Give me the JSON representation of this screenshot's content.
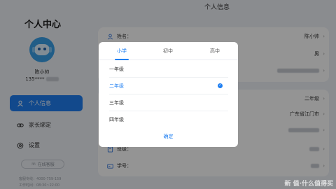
{
  "sidebar": {
    "title": "个人中心",
    "user_name": "陈小帅",
    "phone_prefix": "135****",
    "nav": [
      {
        "label": "个人信息",
        "icon": "user-icon",
        "active": true
      },
      {
        "label": "家长绑定",
        "icon": "link-icon",
        "active": false
      },
      {
        "label": "设置",
        "icon": "gear-icon",
        "active": false
      }
    ],
    "online_service": "在线客服",
    "service_phone": "客服专线：4000-759-159",
    "service_hours": "工作时间：08:30~22:00"
  },
  "main": {
    "title": "个人信息",
    "card1": [
      {
        "label": "姓名：",
        "value": "陈小帅",
        "icon": "user-icon"
      },
      {
        "label": "",
        "value": "男",
        "icon": ""
      },
      {
        "label": "",
        "value": "",
        "icon": ""
      }
    ],
    "card2": [
      {
        "label": "",
        "value": "二年级",
        "icon": ""
      },
      {
        "label": "",
        "value": "广东省江门市",
        "icon": ""
      },
      {
        "label": "",
        "value": "",
        "icon": ""
      },
      {
        "label": "班级：",
        "value": "",
        "icon": "class-icon"
      },
      {
        "label": "学号：",
        "value": "",
        "icon": "id-card-icon"
      }
    ]
  },
  "modal": {
    "tabs": [
      "小学",
      "初中",
      "高中"
    ],
    "active_tab": 0,
    "options": [
      "一年级",
      "二年级",
      "三年级",
      "四年级"
    ],
    "selected_option": 1,
    "confirm": "确定"
  },
  "watermark": "新 值·什么值得买",
  "colors": {
    "accent": "#1f7ff2",
    "background": "#eef1f6"
  }
}
